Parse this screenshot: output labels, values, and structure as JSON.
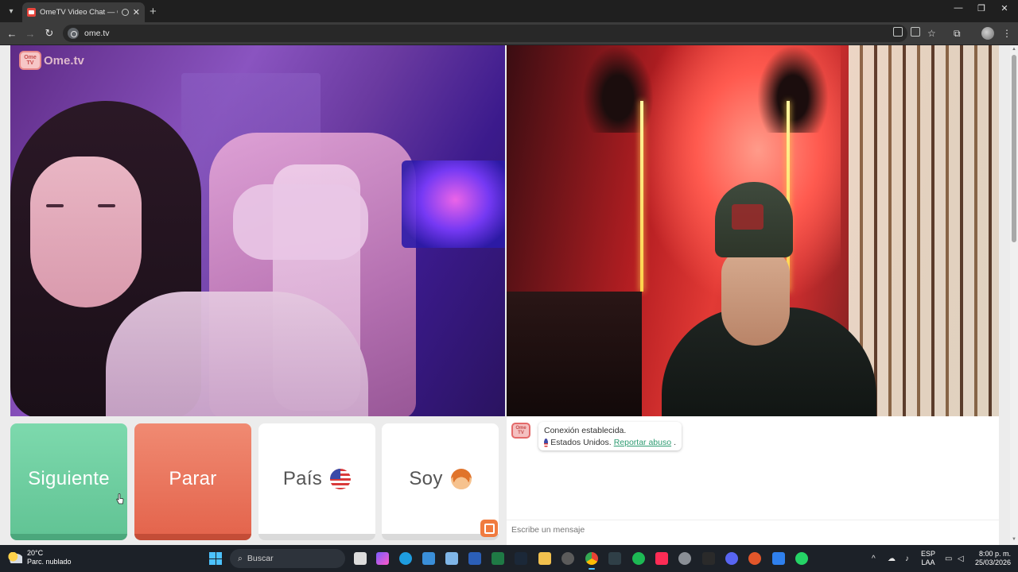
{
  "browser": {
    "tab_title": "OmeTV Video Chat — Ome",
    "url": "ome.tv"
  },
  "page": {
    "logo_text": "Ome.tv",
    "logo_badge_line1": "Ome",
    "logo_badge_line2": "TV",
    "buttons": {
      "next_label": "Siguiente",
      "stop_label": "Parar",
      "country_label": "País",
      "gender_label": "Soy"
    },
    "chat": {
      "avatar_line1": "Ome",
      "avatar_line2": "TV",
      "connection_message": "Conexión establecida.",
      "country_name": "Estados Unidos.",
      "report_link": "Reportar abuso",
      "report_suffix": ".",
      "input_placeholder": "Escribe un mensaje"
    }
  },
  "taskbar": {
    "temperature": "20°C",
    "weather_desc": "Parc. nublado",
    "search_label": "Buscar",
    "lang_line1": "ESP",
    "lang_line2": "LAA",
    "time": "8:00 p. m.",
    "date": "25/03/2026"
  },
  "colors": {
    "next_button": "#62c495",
    "stop_button": "#e4654d",
    "link_green": "#2e9c72",
    "send_orange": "#f07b3f"
  }
}
